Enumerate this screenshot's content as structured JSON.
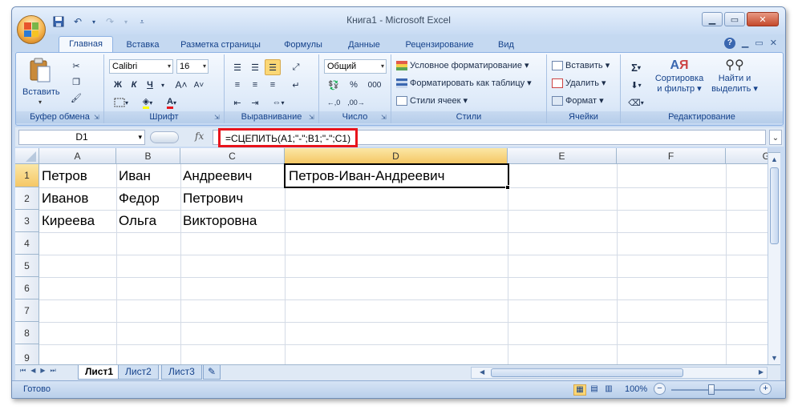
{
  "window": {
    "title": "Книга1 - Microsoft Excel"
  },
  "tabs": [
    "Главная",
    "Вставка",
    "Разметка страницы",
    "Формулы",
    "Данные",
    "Рецензирование",
    "Вид"
  ],
  "ribbon": {
    "clipboard": {
      "label": "Буфер обмена",
      "paste": "Вставить"
    },
    "font": {
      "label": "Шрифт",
      "name": "Calibri",
      "size": "16",
      "bold": "Ж",
      "italic": "К",
      "underline": "Ч",
      "grow": "A˄",
      "shrink": "A˅"
    },
    "alignment": {
      "label": "Выравнивание"
    },
    "number": {
      "label": "Число",
      "format": "Общий",
      "percent": "%",
      "thousands": "000"
    },
    "styles": {
      "label": "Стили",
      "conditional": "Условное форматирование",
      "table": "Форматировать как таблицу",
      "cell_styles": "Стили ячеек"
    },
    "cells": {
      "label": "Ячейки",
      "insert": "Вставить",
      "delete": "Удалить",
      "format": "Формат"
    },
    "editing": {
      "label": "Редактирование",
      "sort": "Сортировка",
      "sort2": "и фильтр",
      "find": "Найти и",
      "find2": "выделить",
      "sigma": "Σ"
    }
  },
  "formula_bar": {
    "name_box": "D1",
    "fx": "fx",
    "formula": "=СЦЕПИТЬ(A1;\"-\";B1;\"-\";C1)"
  },
  "columns": [
    "A",
    "B",
    "C",
    "D",
    "E",
    "F",
    "G"
  ],
  "rows": [
    "1",
    "2",
    "3",
    "4",
    "5",
    "6",
    "7",
    "8",
    "9"
  ],
  "cells": {
    "r1": {
      "a": "Петров",
      "b": "Иван",
      "c": "Андреевич",
      "d": "Петров-Иван-Андреевич"
    },
    "r2": {
      "a": "Иванов",
      "b": "Федор",
      "c": "Петрович"
    },
    "r3": {
      "a": "Киреева",
      "b": "Ольга",
      "c": "Викторовна"
    }
  },
  "sheets": [
    "Лист1",
    "Лист2",
    "Лист3"
  ],
  "status": {
    "ready": "Готово",
    "zoom": "100%"
  },
  "colors": {
    "highlight": "#e8141c",
    "selection_header": "#f5c765"
  }
}
